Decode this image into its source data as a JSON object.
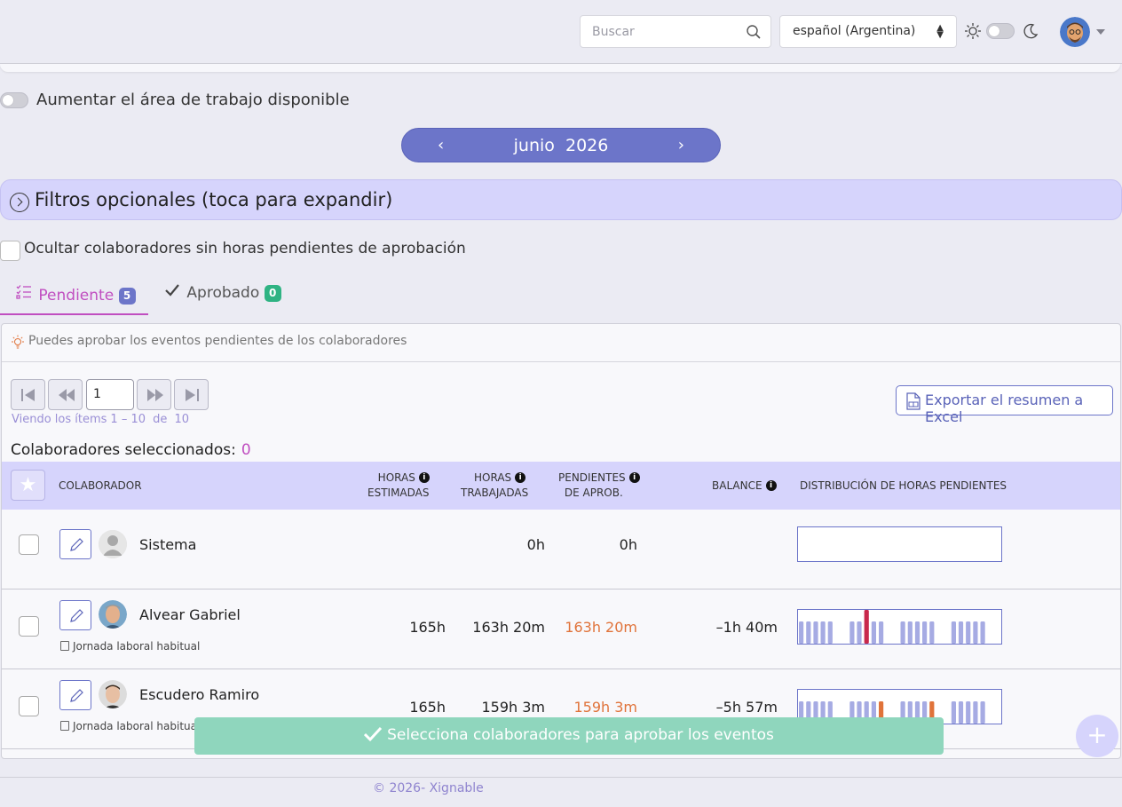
{
  "header": {
    "search_placeholder": "Buscar",
    "language": "español (Argentina)",
    "theme_toggle_on": false
  },
  "workarea": {
    "label": "Aumentar el área de trabajo disponible",
    "enabled": false
  },
  "month_nav": {
    "prev": "‹",
    "month": "junio",
    "year": "2026",
    "next": "›"
  },
  "filters": {
    "label": "Filtros opcionales (toca para expandir)"
  },
  "hide_option": {
    "label": "Ocultar colaboradores sin horas pendientes de aprobación",
    "checked": false
  },
  "tabs": [
    {
      "label": "Pendiente",
      "count": "5",
      "active": true
    },
    {
      "label": "Aprobado",
      "count": "0",
      "active": false
    }
  ],
  "hint": "Puedes aprobar los eventos pendientes de los colaboradores",
  "pagination": {
    "page": "1",
    "viewing_prefix": "Viendo los ítems",
    "range": "1 – 10",
    "of": "de",
    "total": "10"
  },
  "export_label": "Exportar el resumen a Excel",
  "selected": {
    "label": "Colaboradores seleccionados:",
    "count": "0"
  },
  "columns": {
    "collaborator": "COLABORADOR",
    "estimated": [
      "HORAS",
      "ESTIMADAS"
    ],
    "worked": [
      "HORAS",
      "TRABAJADAS"
    ],
    "pending": [
      "PENDIENTES",
      "DE APROB."
    ],
    "balance": "BALANCE",
    "distribution": "DISTRIBUCIÓN DE HORAS PENDIENTES"
  },
  "rows": [
    {
      "name": "Sistema",
      "schedule": "",
      "estimated": "",
      "worked": "0h",
      "pending": "0h",
      "balance": "",
      "bars": []
    },
    {
      "name": "Alvear Gabriel",
      "schedule": "Jornada laboral habitual",
      "estimated": "165h",
      "worked": "163h 20m",
      "pending": "163h 20m",
      "balance": "–1h 40m",
      "bars": [
        1,
        1,
        1,
        1,
        1,
        0,
        0,
        1,
        1,
        2,
        1,
        1,
        0,
        0,
        1,
        1,
        1,
        1,
        1,
        0,
        0,
        1,
        1,
        1,
        1,
        1,
        0,
        0
      ]
    },
    {
      "name": "Escudero Ramiro",
      "schedule": "Jornada laboral habitual",
      "estimated": "165h",
      "worked": "159h 3m",
      "pending": "159h 3m",
      "balance": "–5h 57m",
      "bars": [
        1,
        1,
        1,
        1,
        1,
        0,
        0,
        1,
        1,
        1,
        1,
        3,
        0,
        0,
        1,
        1,
        1,
        1,
        3,
        0,
        0,
        1,
        1,
        1,
        1,
        1,
        0,
        0
      ]
    }
  ],
  "colors": {
    "bar_normal": "#a6abe3",
    "bar_holiday": "#c8284c",
    "bar_over": "#e0733a",
    "accent": "#6c75c9",
    "pink": "#c04ec0"
  },
  "toast": "Selecciona colaboradores para aprobar los eventos",
  "fab_label": "+",
  "footer": "© 2026- Xignable"
}
